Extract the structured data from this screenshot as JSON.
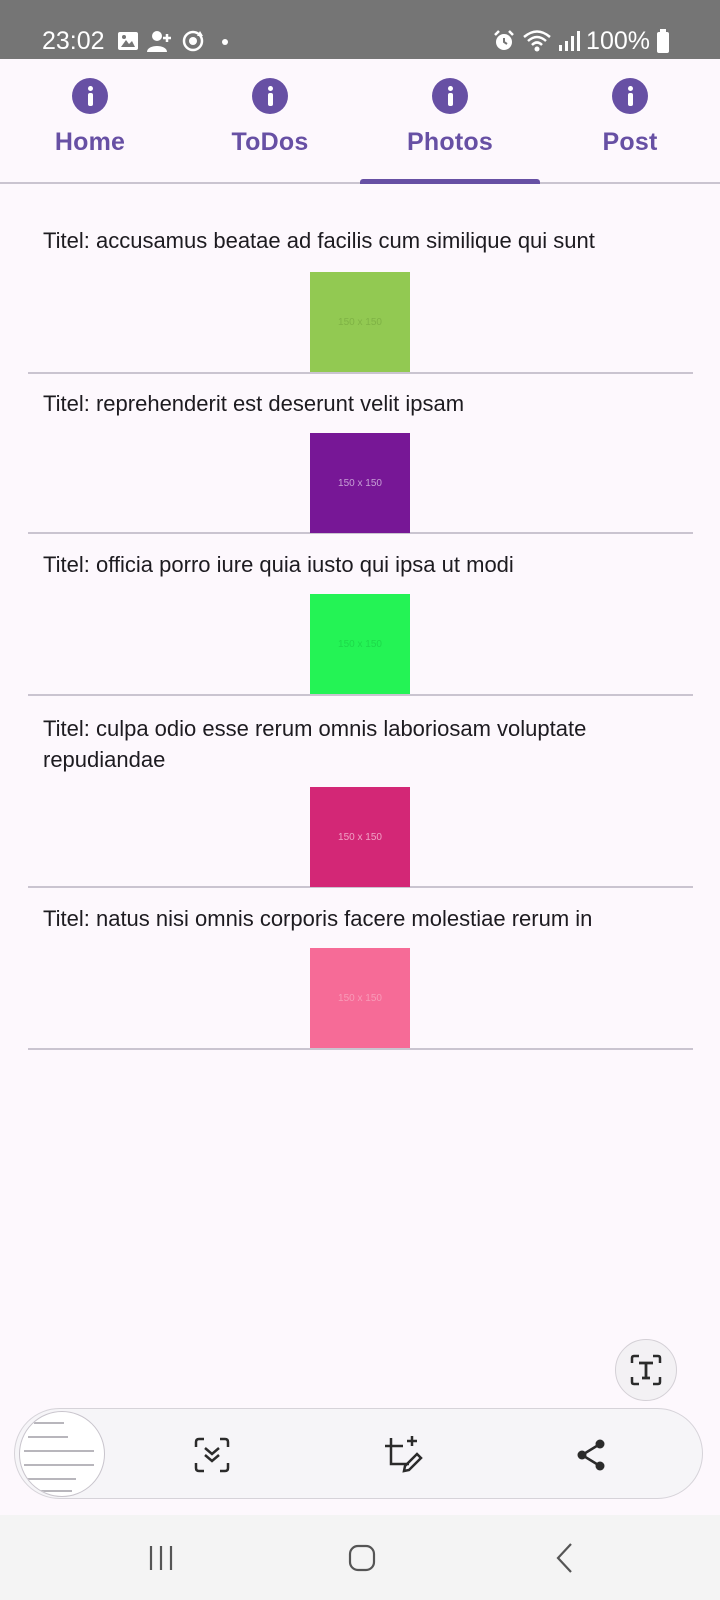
{
  "status_bar": {
    "time": "23:02",
    "battery": "100%",
    "left_icons": [
      "gallery-icon",
      "person-add-icon",
      "sync-icon",
      "dot-icon"
    ],
    "right_icons": [
      "alarm-icon",
      "wifi-icon",
      "signal-icon",
      "battery-icon"
    ]
  },
  "tabs": [
    {
      "label": "Home",
      "icon": "info-icon",
      "selected": false
    },
    {
      "label": "ToDos",
      "icon": "info-icon",
      "selected": false
    },
    {
      "label": "Photos",
      "icon": "info-icon",
      "selected": true
    },
    {
      "label": "Post",
      "icon": "info-icon",
      "selected": false
    }
  ],
  "photos": [
    {
      "title": "Titel: accusamus beatae ad facilis cum similique qui sunt",
      "thumb_label": "150 x 150",
      "color": "#92c952",
      "text_color": "#7fb245"
    },
    {
      "title": "Titel: reprehenderit est deserunt velit ipsam",
      "thumb_label": "150 x 150",
      "color": "#771796",
      "text_color": "#c79fd6"
    },
    {
      "title": "Titel: officia porro iure quia iusto qui ipsa ut modi",
      "thumb_label": "150 x 150",
      "color": "#24f355",
      "text_color": "#1ed94a"
    },
    {
      "title": "Titel: culpa odio esse rerum omnis laboriosam voluptate repudiandae",
      "thumb_label": "150 x 150",
      "color": "#d32776",
      "text_color": "#f0a3c6"
    },
    {
      "title": "Titel: natus nisi omnis corporis facere molestiae rerum in",
      "thumb_label": "150 x 150",
      "color": "#f66b97",
      "text_color": "#f89bb8"
    }
  ],
  "floating": {
    "extract_text_icon": "text-extract-icon"
  },
  "screenshot_toolbar": {
    "icons": [
      "scroll-capture-icon",
      "crop-edit-icon",
      "share-icon"
    ]
  },
  "nav_bar": {
    "icons": [
      "recents-icon",
      "home-icon",
      "back-icon"
    ]
  },
  "colors": {
    "accent": "#6750a4",
    "background": "#fdf8fd",
    "divider": "#cac4d0",
    "status_bar": "#757575"
  }
}
